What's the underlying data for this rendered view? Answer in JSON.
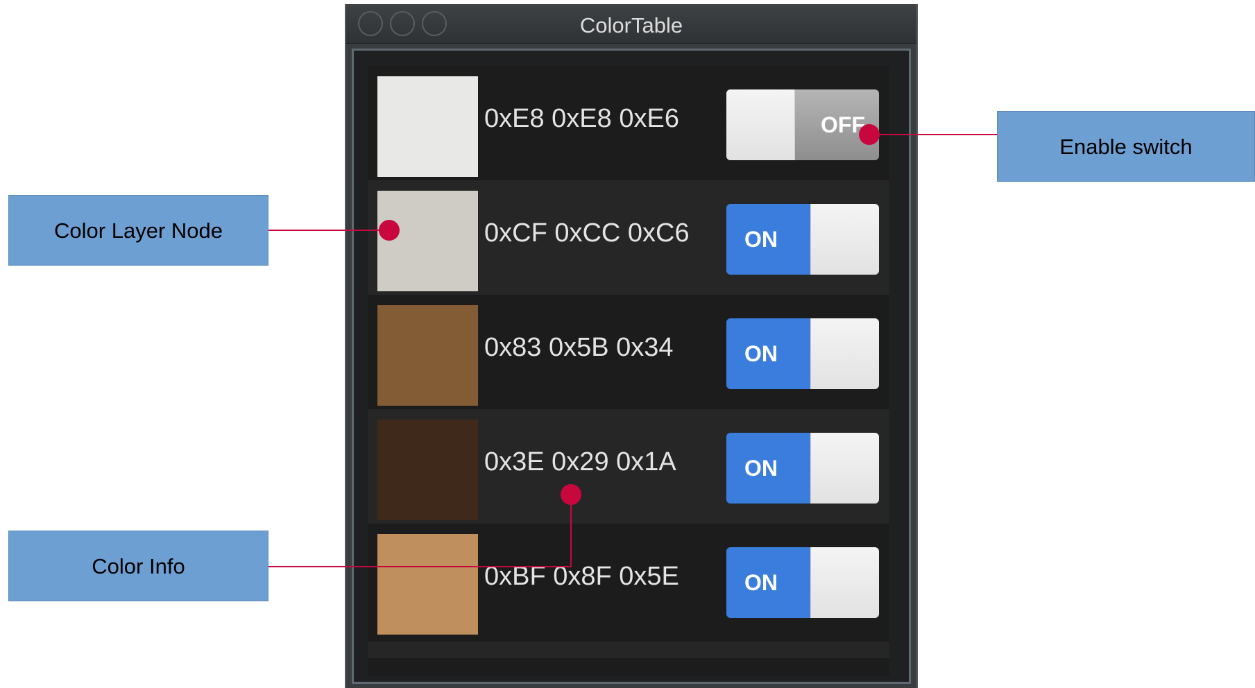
{
  "window": {
    "title": "ColorTable"
  },
  "rows": [
    {
      "color": "#E8E8E6",
      "hex": "0xE8 0xE8 0xE6",
      "switch": "OFF"
    },
    {
      "color": "#CFCCC6",
      "hex": "0xCF 0xCC 0xC6",
      "switch": "ON"
    },
    {
      "color": "#835B34",
      "hex": "0x83 0x5B 0x34",
      "switch": "ON"
    },
    {
      "color": "#3E291A",
      "hex": "0x3E 0x29 0x1A",
      "switch": "ON"
    },
    {
      "color": "#BF8F5E",
      "hex": "0xBF 0x8F 0x5E",
      "switch": "ON"
    }
  ],
  "callouts": {
    "enable_switch": "Enable switch",
    "color_layer_node": "Color Layer Node",
    "color_info": "Color Info"
  },
  "colors": {
    "switch_on": "#3B7DDC",
    "callout_fill": "#6E9FD3",
    "callout_marker": "#C8073F"
  }
}
